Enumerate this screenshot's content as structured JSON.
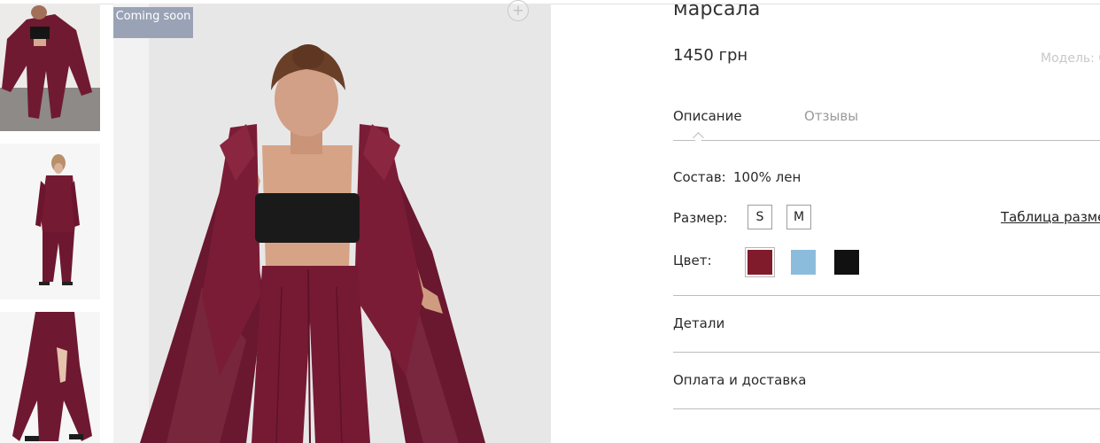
{
  "product": {
    "title": "марсала",
    "price": "1450 грн",
    "model_label": "Модель: С",
    "badge": "Coming soon",
    "zoom_symbol": "+"
  },
  "tabs": [
    {
      "label": "Описание",
      "active": true
    },
    {
      "label": "Отзывы",
      "active": false
    }
  ],
  "composition": {
    "label": "Состав:",
    "value": "100% лен"
  },
  "sizes": {
    "label": "Размер:",
    "options": [
      "S",
      "M"
    ],
    "chart_link": "Таблица разме"
  },
  "colors": {
    "label": "Цвет:",
    "swatches": [
      {
        "name": "марсала",
        "hex": "#801b2c",
        "selected": true
      },
      {
        "name": "голубой",
        "hex": "#8bbcdc",
        "selected": false
      },
      {
        "name": "черный",
        "hex": "#111111",
        "selected": false
      }
    ]
  },
  "accordion": [
    {
      "label": "Детали"
    },
    {
      "label": "Оплата и доставка"
    }
  ],
  "icons": {
    "zoom": "plus-icon",
    "tab_pointer": "caret-up-icon"
  }
}
